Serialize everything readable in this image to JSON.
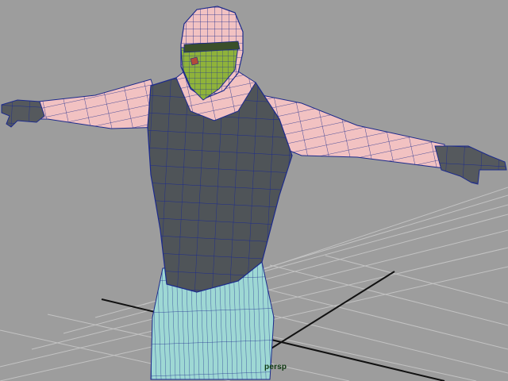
{
  "viewport": {
    "camera_label": "persp",
    "background_color": "#9d9d9d",
    "grid_color": "#c3c3c3",
    "axis_color": "#111111",
    "wire_color": "#1c2a8c",
    "skin_color": "#f2c2c2",
    "shirt_color": "#4f5458",
    "mask_color": "#8fb33a",
    "pants_color": "#9ed8d4"
  }
}
